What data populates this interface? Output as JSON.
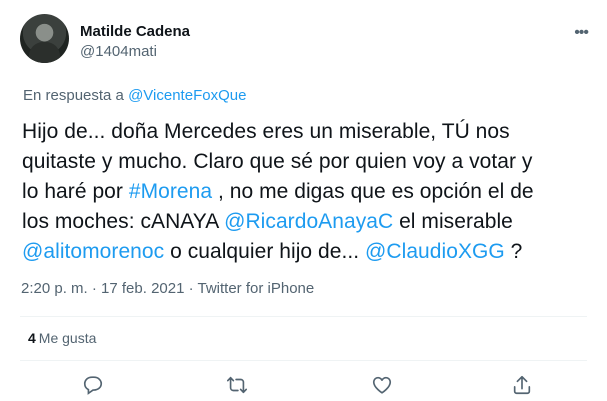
{
  "user": {
    "display_name": "Matilde Cadena",
    "handle": "@1404mati"
  },
  "reply": {
    "prefix": "En respuesta a ",
    "mention": "@VicenteFoxQue"
  },
  "tweet": {
    "line1": "Hijo de... doña Mercedes eres un miserable, TÚ nos",
    "line2": "quitaste y mucho. Claro que sé por quien voy a votar y",
    "line3_a": "lo haré por ",
    "line3_link": "#Morena",
    "line3_b": " , no me digas que es opción el de",
    "line4_a": "los moches: cANAYA ",
    "line4_link": "@RicardoAnayaC",
    "line4_b": " el miserable",
    "line5_link1": "@alitomorenoc",
    "line5_a": " o cualquier hijo de... ",
    "line5_link2": "@ClaudioXGG",
    "line5_b": " ?"
  },
  "meta": "2:20 p. m. · 17 feb. 2021 · Twitter for iPhone",
  "likes": {
    "count": "4",
    "label": "Me gusta"
  },
  "actions": [
    "reply-icon",
    "retweet-icon",
    "like-icon",
    "share-icon"
  ],
  "colors": {
    "link": "#1d9bf0",
    "text": "#0f1419",
    "secondary": "#536471"
  }
}
